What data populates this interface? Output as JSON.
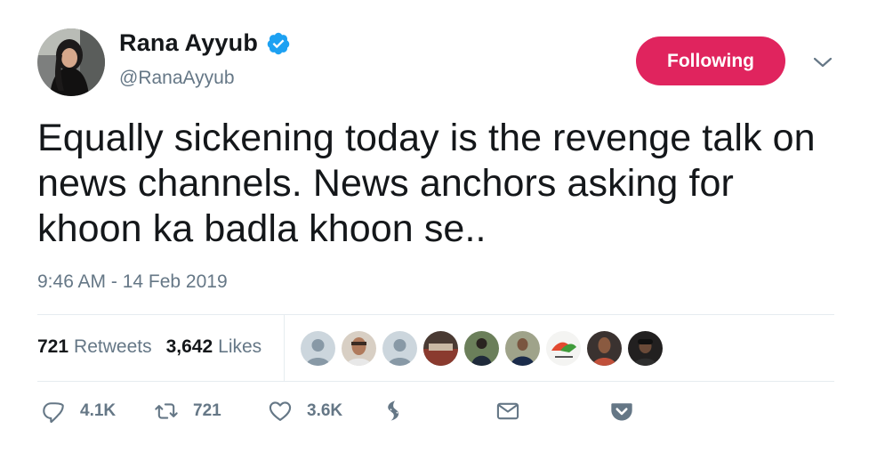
{
  "author": {
    "name": "Rana Ayyub",
    "handle": "@RanaAyyub",
    "verified": true
  },
  "follow_button": {
    "label": "Following",
    "color": "#e0245e"
  },
  "tweet": {
    "text": "Equally sickening today is the revenge talk on news channels. News anchors asking for khoon ka badla khoon se..",
    "timestamp": "9:46 AM - 14 Feb 2019"
  },
  "stats": {
    "retweets_count": "721",
    "retweets_label": "Retweets",
    "likes_count": "3,642",
    "likes_label": "Likes"
  },
  "likers": [
    {
      "icon": "default-avatar"
    },
    {
      "icon": "user-avatar"
    },
    {
      "icon": "default-avatar"
    },
    {
      "icon": "user-avatar"
    },
    {
      "icon": "user-avatar"
    },
    {
      "icon": "user-avatar"
    },
    {
      "icon": "logo-avatar"
    },
    {
      "icon": "user-avatar"
    },
    {
      "icon": "user-avatar"
    }
  ],
  "actions": {
    "reply_count": "4.1K",
    "retweet_count": "721",
    "like_count": "3.6K"
  },
  "colors": {
    "text": "#14171a",
    "secondary": "#657786",
    "verified": "#1da1f2",
    "divider": "#e6ecf0"
  }
}
